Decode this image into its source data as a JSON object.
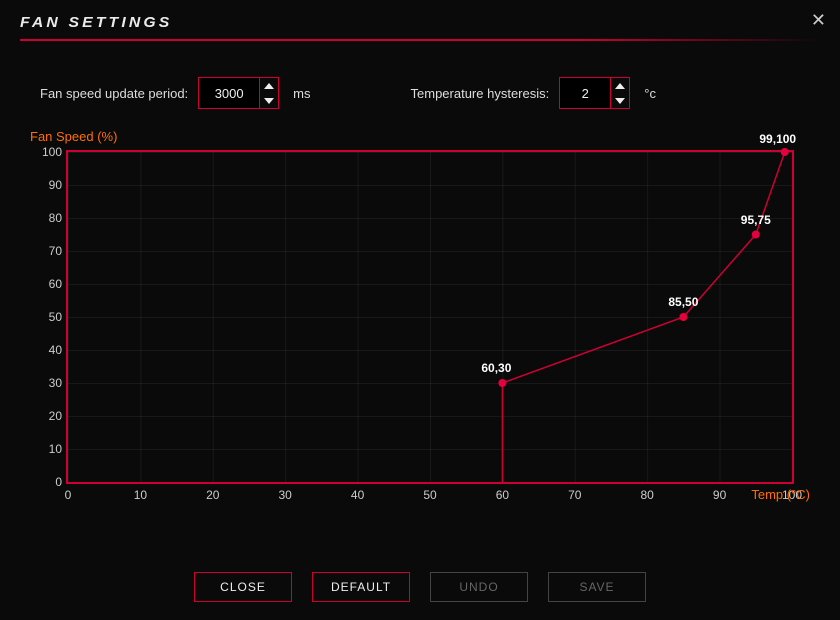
{
  "title": "FAN SETTINGS",
  "params": {
    "update_period": {
      "label": "Fan speed update period:",
      "value": "3000",
      "unit": "ms"
    },
    "hysteresis": {
      "label": "Temperature hysteresis:",
      "value": "2",
      "unit": "°c"
    }
  },
  "chart_data": {
    "type": "line",
    "ylabel": "Fan Speed (%)",
    "xlabel": "Temp (°C)",
    "xlim": [
      0,
      100
    ],
    "ylim": [
      0,
      100
    ],
    "xticks": [
      0,
      10,
      20,
      30,
      40,
      50,
      60,
      70,
      80,
      90,
      100
    ],
    "yticks": [
      0,
      10,
      20,
      30,
      40,
      50,
      60,
      70,
      80,
      90,
      100
    ],
    "points": [
      {
        "x": 60,
        "y": 30,
        "label": "60,30"
      },
      {
        "x": 85,
        "y": 50,
        "label": "85,50"
      },
      {
        "x": 95,
        "y": 75,
        "label": "95,75"
      },
      {
        "x": 99,
        "y": 100,
        "label": "99,100"
      }
    ],
    "line_color": "#cc0033",
    "point_color": "#e6003d"
  },
  "buttons": {
    "close": "CLOSE",
    "default": "DEFAULT",
    "undo": "UNDO",
    "save": "SAVE"
  }
}
